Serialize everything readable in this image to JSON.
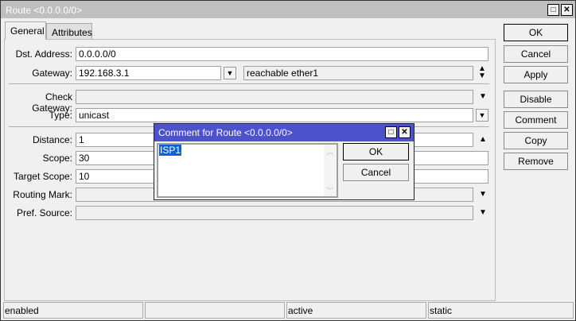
{
  "window": {
    "title": "Route <0.0.0.0/0>"
  },
  "tabs": [
    {
      "label": "General"
    },
    {
      "label": "Attributes"
    }
  ],
  "form": {
    "dst_address": {
      "label": "Dst. Address:",
      "value": "0.0.0.0/0"
    },
    "gateway": {
      "label": "Gateway:",
      "value": "192.168.3.1",
      "status": "reachable ether1"
    },
    "check_gateway": {
      "label": "Check Gateway:",
      "value": ""
    },
    "type": {
      "label": "Type:",
      "value": "unicast"
    },
    "distance": {
      "label": "Distance:",
      "value": "1"
    },
    "scope": {
      "label": "Scope:",
      "value": "30"
    },
    "target_scope": {
      "label": "Target Scope:",
      "value": "10"
    },
    "routing_mark": {
      "label": "Routing Mark:",
      "value": ""
    },
    "pref_source": {
      "label": "Pref. Source:",
      "value": ""
    }
  },
  "buttons": {
    "ok": "OK",
    "cancel": "Cancel",
    "apply": "Apply",
    "disable": "Disable",
    "comment": "Comment",
    "copy": "Copy",
    "remove": "Remove"
  },
  "status": [
    "enabled",
    "",
    "active",
    "static"
  ],
  "dialog": {
    "title": "Comment for Route <0.0.0.0/0>",
    "comment": "ISP1",
    "ok": "OK",
    "cancel": "Cancel"
  }
}
